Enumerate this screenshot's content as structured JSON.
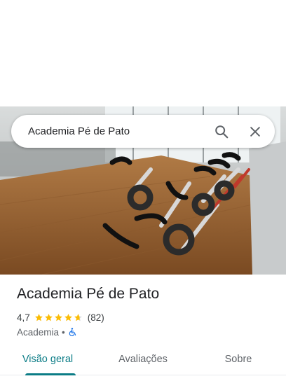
{
  "search": {
    "query": "Academia Pé de Pato",
    "search_icon": "search-icon",
    "close_icon": "close-icon"
  },
  "hero": {
    "photo": "spin-bikes-gym-photo"
  },
  "place": {
    "title": "Academia Pé de Pato",
    "rating": "4,7",
    "rating_value": 4.7,
    "review_count": "(82)",
    "category": "Academia",
    "separator": "•",
    "accessibility_icon": "wheelchair-icon"
  },
  "tabs": [
    {
      "label": "Visão geral",
      "active": true
    },
    {
      "label": "Avaliações",
      "active": false
    },
    {
      "label": "Sobre",
      "active": false
    }
  ],
  "colors": {
    "accent": "#0b7c86",
    "star": "#fbbc04",
    "accessibility": "#1a73e8"
  }
}
